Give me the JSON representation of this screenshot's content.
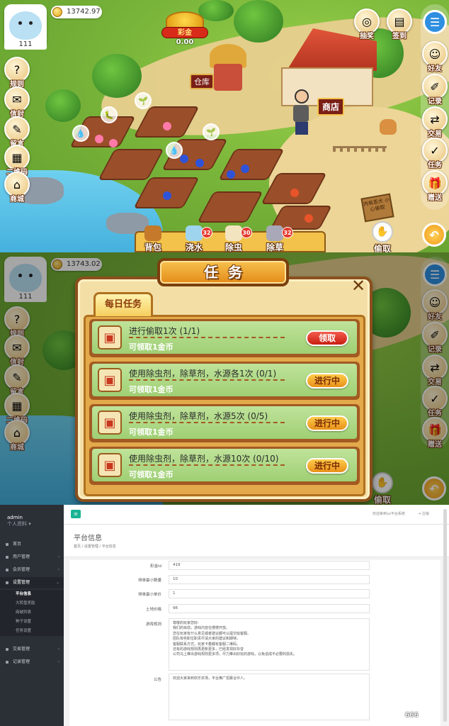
{
  "top_panel": {
    "player_id": "111",
    "coins": "13742.97",
    "jackpot_label": "彩金",
    "jackpot_value": "0.00",
    "left_buttons": [
      {
        "icon": "question-icon",
        "label": "规则"
      },
      {
        "icon": "envelope-icon",
        "label": "信封"
      },
      {
        "icon": "pencil-icon",
        "label": "留言"
      },
      {
        "icon": "qrcode-icon",
        "label": "二维码"
      },
      {
        "icon": "shop-icon",
        "label": "商城"
      }
    ],
    "top_right_buttons": [
      {
        "icon": "lottery-icon",
        "label": "抽奖"
      },
      {
        "icon": "calendar-icon",
        "label": "签到"
      }
    ],
    "right_buttons": [
      {
        "icon": "friend-icon",
        "label": "好友"
      },
      {
        "icon": "notebook-icon",
        "label": "记录"
      },
      {
        "icon": "trade-icon",
        "label": "交易"
      },
      {
        "icon": "task-icon",
        "label": "任务"
      },
      {
        "icon": "gift-icon",
        "label": "赠送"
      }
    ],
    "warehouse_label": "仓库",
    "shop_label": "商店",
    "tools": [
      {
        "label": "背包",
        "badge": ""
      },
      {
        "label": "浇水",
        "badge": "32"
      },
      {
        "label": "除虫",
        "badge": "30"
      },
      {
        "label": "除草",
        "badge": "32"
      }
    ],
    "steal_label": "偷取",
    "wood_sign_text": "内有恶犬 小心偷取"
  },
  "mid_panel": {
    "player_id": "111",
    "coins": "13743.02",
    "left_buttons": [
      {
        "label": "规则"
      },
      {
        "label": "信封"
      },
      {
        "label": "留言"
      },
      {
        "label": "二维码"
      },
      {
        "label": "商城"
      }
    ],
    "right_buttons": [
      {
        "label": "好友"
      },
      {
        "label": "记录"
      },
      {
        "label": "交易"
      },
      {
        "label": "任务"
      },
      {
        "label": "赠送"
      }
    ],
    "steal_label": "偷取"
  },
  "task_dialog": {
    "title": "任务",
    "close": "✕",
    "tab": "每日任务",
    "tasks": [
      {
        "name": "进行偷取1次 (1/1)",
        "reward": "可领取1金币",
        "button": "领取",
        "state": "claim"
      },
      {
        "name": "使用除虫剂，除草剂，水源各1次 (0/1)",
        "reward": "可领取1金币",
        "button": "进行中",
        "state": "progress"
      },
      {
        "name": "使用除虫剂，除草剂，水源5次 (0/5)",
        "reward": "可领取1金币",
        "button": "进行中",
        "state": "progress"
      },
      {
        "name": "使用除虫剂，除草剂，水源10次 (0/10)",
        "reward": "可领取1金币",
        "button": "进行中",
        "state": "progress"
      }
    ]
  },
  "admin_panel": {
    "user_name": "admin",
    "user_sub": "个人资料 ▾",
    "nav": [
      {
        "label": "首页",
        "chev": ""
      },
      {
        "label": "用户管理",
        "chev": "‹"
      },
      {
        "label": "会员管理",
        "chev": "‹"
      },
      {
        "label": "设置管理",
        "chev": "⌄"
      }
    ],
    "sub_nav": [
      "平台信息",
      "大转盘奖励",
      "商城列表",
      "种子设置",
      "任务设置"
    ],
    "nav_after": [
      {
        "label": "交易管理",
        "chev": "‹"
      },
      {
        "label": "记录管理",
        "chev": "‹"
      }
    ],
    "welcome": "欢迎来到xx平台系统",
    "logout": "⇥ 注销",
    "page_title": "平台信息",
    "breadcrumb": "首页  /  设置管理  /  平台信息",
    "fields": [
      {
        "label": "彩金ld",
        "value": "419"
      },
      {
        "label": "排单最小数量",
        "value": "10"
      },
      {
        "label": "排单最小单价",
        "value": "1"
      },
      {
        "label": "土地价格",
        "value": "96"
      }
    ],
    "rules_label": "游戏规则",
    "rules_text": "尊敬的玩家您好:\n我们的目前，游戏内容在慢慢开放。\n您在玩家有什么意见或者建议都可以提交给客服。\n团队有些职位职责尽请大家的建议和期待。\n客服联系方式，玩家卡着都有客服二维码。\n还有的游戏规则再更新更多，已经发现好抖音\n公司马上推出游戏规则更多项，尽力推出好玩的游戏，以免造成不必要的损失。",
    "notice_label": "公告",
    "notice_text": "欢迎大家来到欢乐农场，平台推广招募合伙人。",
    "watermark": "666"
  }
}
